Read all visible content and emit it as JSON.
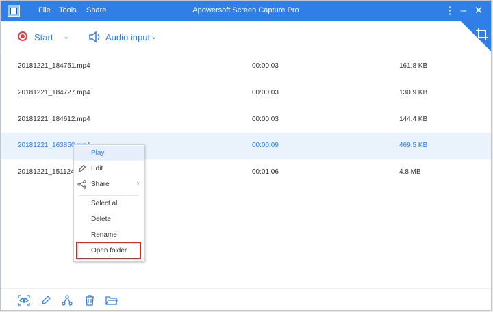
{
  "app": {
    "title": "Apowersoft Screen Capture Pro",
    "menu": [
      "File",
      "Tools",
      "Share"
    ],
    "accent": "#2f7fe6"
  },
  "toolbar": {
    "start_label": "Start",
    "audio_label": "Audio input"
  },
  "files": [
    {
      "name": "20181221_184751.mp4",
      "duration": "00:00:03",
      "size": "161.8 KB"
    },
    {
      "name": "20181221_184727.mp4",
      "duration": "00:00:03",
      "size": "130.9 KB"
    },
    {
      "name": "20181221_184612.mp4",
      "duration": "00:00:03",
      "size": "144.4 KB"
    },
    {
      "name": "20181221_163850.mp4",
      "duration": "00:00:09",
      "size": "469.5 KB"
    },
    {
      "name": "20181221_151124.mp4",
      "duration": "00:01:06",
      "size": "4.8 MB"
    }
  ],
  "context_menu": {
    "play": "Play",
    "edit": "Edit",
    "share": "Share",
    "select_all": "Select all",
    "delete": "Delete",
    "rename": "Rename",
    "open_folder": "Open folder"
  },
  "footer_icons": [
    "eye-icon",
    "pencil-icon",
    "share-icon",
    "trash-icon",
    "folder-icon"
  ]
}
